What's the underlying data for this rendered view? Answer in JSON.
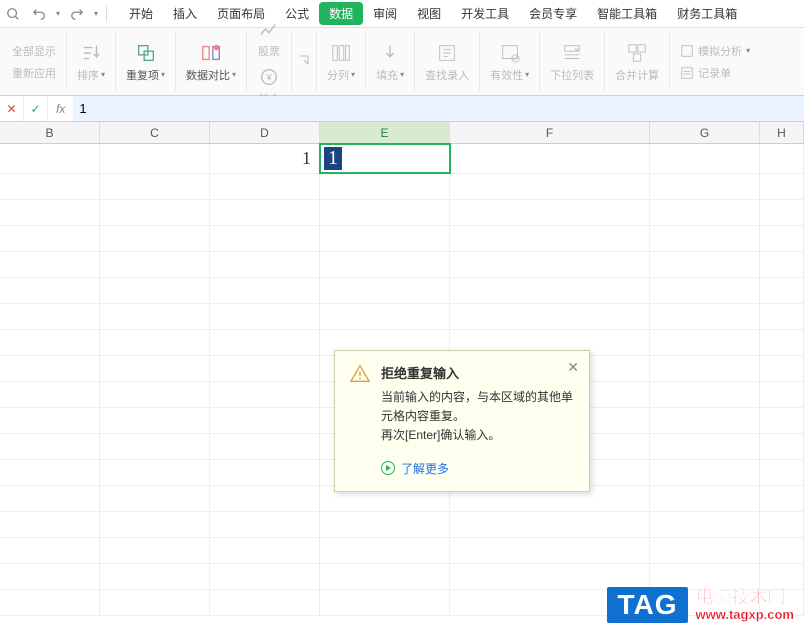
{
  "qat": {
    "undo": "↶",
    "redo": "↷"
  },
  "tabs": [
    "开始",
    "插入",
    "页面布局",
    "公式",
    "数据",
    "审阅",
    "视图",
    "开发工具",
    "会员专享",
    "智能工具箱",
    "财务工具箱"
  ],
  "active_tab_index": 4,
  "ribbon": {
    "left1": "全部显示",
    "left2": "重新应用",
    "sort": "排序",
    "dup": "重复项",
    "dataCompare": "数据对比",
    "stock": "股票",
    "fund": "基金",
    "split": "分列",
    "fill": "填充",
    "findInput": "查找录入",
    "validity": "有效性",
    "dropdown": "下拉列表",
    "consolidate": "合并计算",
    "simAnalysis": "模拟分析",
    "recordForm": "记录单"
  },
  "formula_bar": {
    "fx": "fx",
    "value": "1"
  },
  "columns": [
    "B",
    "C",
    "D",
    "E",
    "F",
    "G",
    "H"
  ],
  "active_col": "E",
  "cells": {
    "D1": "1",
    "E1": "1"
  },
  "tooltip": {
    "title": "拒绝重复输入",
    "line1": "当前输入的内容，与本区域的其他单元格内容重复。",
    "line2": "再次[Enter]确认输入。",
    "link": "了解更多"
  },
  "watermark": {
    "tag": "TAG",
    "cn": "电脑技术网",
    "url": "www.tagxp.com"
  }
}
